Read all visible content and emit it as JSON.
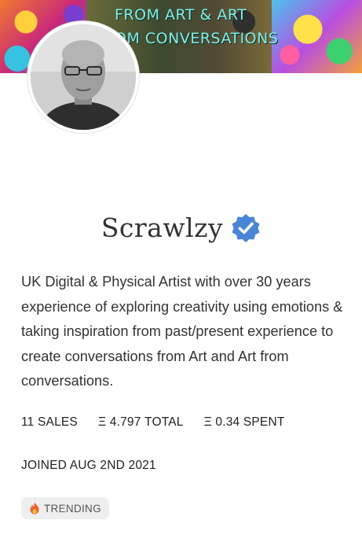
{
  "banner": {
    "line1": "FROM ART & ART",
    "line2": "OM CONVERSATIONS"
  },
  "profile": {
    "name": "Scrawlzy",
    "verified": true,
    "bio": "UK Digital & Physical Artist with over 30 years experience of exploring creativity using emotions & taking inspiration from past/present experience to create conversations from Art and Art from conversations."
  },
  "stats": {
    "sales": "11 SALES",
    "total": "Ξ 4.797 TOTAL",
    "spent": "Ξ 0.34 SPENT"
  },
  "joined": "JOINED AUG 2ND 2021",
  "badge": {
    "label": "TRENDING",
    "icon": "fire-icon"
  },
  "colors": {
    "verified": "#4a86d8",
    "badge_bg": "#eeeeee",
    "text": "#333333"
  }
}
